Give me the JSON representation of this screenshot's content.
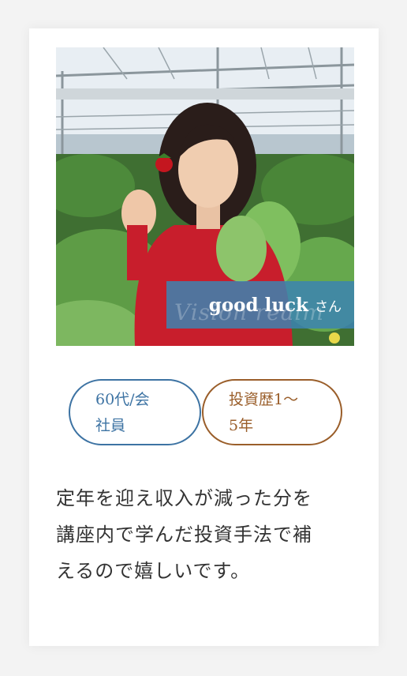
{
  "card": {
    "person_name": "good luck",
    "honorific": "さん",
    "watermark": "Vision realm",
    "tags": {
      "age": [
        "60代/会",
        "社員"
      ],
      "experience": [
        "投資歴1〜",
        "5年"
      ]
    },
    "quote_lines": [
      "定年を迎え収入が減った分を",
      "講座内で学んだ投資手法で補",
      "えるので嬉しいです。"
    ]
  },
  "colors": {
    "accent_blue": "#3d73a3",
    "accent_brown": "#9a5e2a",
    "name_plate": "#3c84b2"
  }
}
